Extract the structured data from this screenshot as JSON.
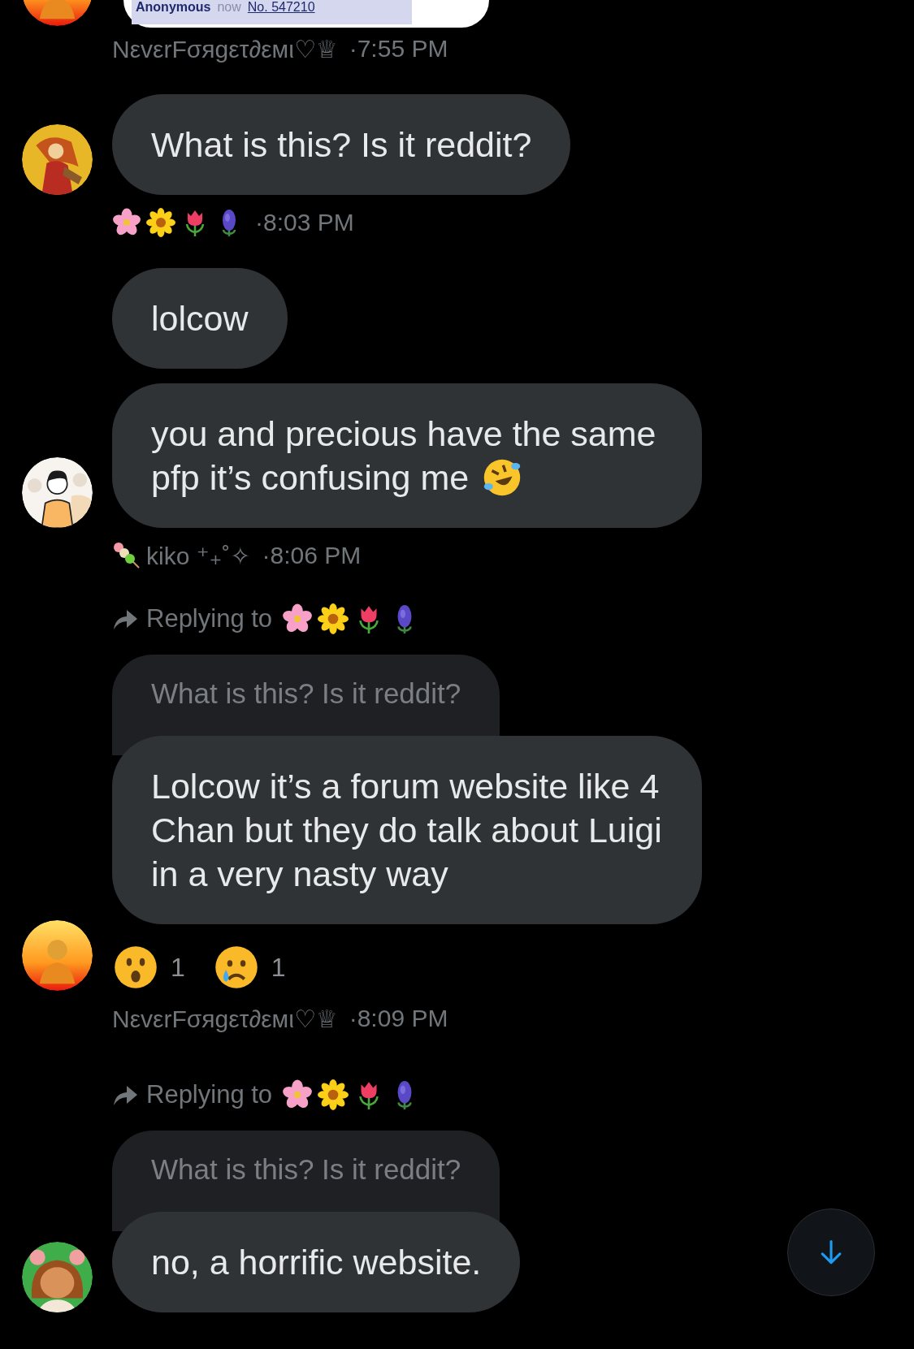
{
  "top_preview": {
    "author": "Anonymous",
    "time": "now",
    "post_no": "No. 547210",
    "avatar": {
      "kind": "fire"
    }
  },
  "items": [
    {
      "kind": "meta",
      "name": "NεvεrFσяgετ∂εмι♡♕",
      "time": "·7:55 PM"
    },
    {
      "kind": "message",
      "avatar": {
        "kind": "golden"
      },
      "text": "What is this? Is it reddit?"
    },
    {
      "kind": "meta",
      "icons": [
        {
          "kind": "blossom"
        },
        {
          "kind": "sunflower"
        },
        {
          "kind": "tulip"
        },
        {
          "kind": "hyacinth"
        }
      ],
      "time": "·8:03 PM"
    },
    {
      "kind": "message",
      "text": "lolcow"
    },
    {
      "kind": "message",
      "avatar": {
        "kind": "doodle"
      },
      "text": "you and precious have the same pfp it’s confusing me",
      "trailing_icon": {
        "kind": "rofl"
      }
    },
    {
      "kind": "meta",
      "icons": [
        {
          "kind": "dango"
        }
      ],
      "name": "kiko ⁺₊˚✧",
      "time": "·8:06 PM"
    },
    {
      "kind": "message",
      "reply": {
        "label": "Replying to",
        "icons": [
          {
            "kind": "blossom"
          },
          {
            "kind": "sunflower"
          },
          {
            "kind": "tulip"
          },
          {
            "kind": "hyacinth"
          }
        ],
        "quote": "What is this? Is it reddit?"
      },
      "avatar": {
        "kind": "sunset"
      },
      "text": "Lolcow it’s a forum website like 4 Chan but they do talk about Luigi in a very nasty way",
      "reactions": [
        {
          "kind": "astonished",
          "count": "1"
        },
        {
          "kind": "crying",
          "count": "1"
        }
      ]
    },
    {
      "kind": "meta",
      "name": "NεvεrFσяgετ∂εмι♡♕",
      "time": "·8:09 PM"
    },
    {
      "kind": "message",
      "reply": {
        "label": "Replying to",
        "icons": [
          {
            "kind": "blossom"
          },
          {
            "kind": "sunflower"
          },
          {
            "kind": "tulip"
          },
          {
            "kind": "hyacinth"
          }
        ],
        "quote": "What is this? Is it reddit?"
      },
      "avatar": {
        "kind": "cartoon-kid"
      },
      "text": "no, a horrific website."
    }
  ],
  "scroll_down_button": true
}
